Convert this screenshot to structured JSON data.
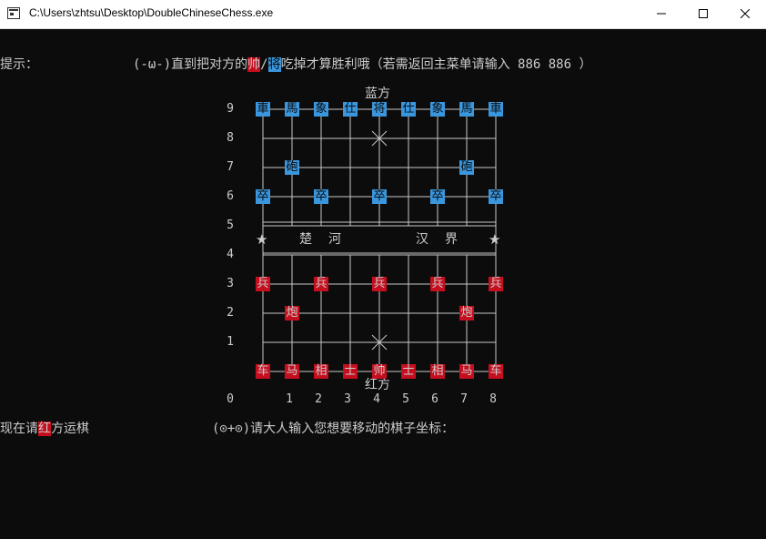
{
  "window": {
    "title": "C:\\Users\\zhtsu\\Desktop\\DoubleChineseChess.exe"
  },
  "console": {
    "hint_label": "提示：",
    "hint_prefix": "(-ω-)直到把对方的",
    "hint_red_piece": "帅",
    "hint_sep": "/",
    "hint_blue_piece": "将",
    "hint_suffix": "吃掉才算胜利哦（若需返回主菜单请输入 886 886 ）",
    "turn_prefix": "现在请",
    "turn_side": "红",
    "turn_suffix": "方运棋",
    "prompt": "(⊙+⊙)请大人输入您想要移动的棋子坐标：",
    "side_blue": "蓝方",
    "side_red": "红方",
    "river_left": [
      "楚",
      "河"
    ],
    "river_right": [
      "汉",
      "界"
    ],
    "river_marker_left": "★",
    "river_marker_right": "★",
    "row_labels": [
      "9",
      "8",
      "7",
      "6",
      "5",
      "4",
      "3",
      "2",
      "1"
    ],
    "col_labels": [
      "0",
      "1",
      "2",
      "3",
      "4",
      "5",
      "6",
      "7",
      "8"
    ],
    "palace_mark": "╳"
  },
  "pieces": {
    "blue": [
      {
        "label": "車",
        "col": 0,
        "row": 9
      },
      {
        "label": "馬",
        "col": 1,
        "row": 9
      },
      {
        "label": "象",
        "col": 2,
        "row": 9
      },
      {
        "label": "仕",
        "col": 3,
        "row": 9
      },
      {
        "label": "将",
        "col": 4,
        "row": 9
      },
      {
        "label": "仕",
        "col": 5,
        "row": 9
      },
      {
        "label": "象",
        "col": 6,
        "row": 9
      },
      {
        "label": "馬",
        "col": 7,
        "row": 9
      },
      {
        "label": "車",
        "col": 8,
        "row": 9
      },
      {
        "label": "砲",
        "col": 1,
        "row": 7
      },
      {
        "label": "砲",
        "col": 7,
        "row": 7
      },
      {
        "label": "卒",
        "col": 0,
        "row": 6
      },
      {
        "label": "卒",
        "col": 2,
        "row": 6
      },
      {
        "label": "卒",
        "col": 4,
        "row": 6
      },
      {
        "label": "卒",
        "col": 6,
        "row": 6
      },
      {
        "label": "卒",
        "col": 8,
        "row": 6
      }
    ],
    "red": [
      {
        "label": "兵",
        "col": 0,
        "row": 3
      },
      {
        "label": "兵",
        "col": 2,
        "row": 3
      },
      {
        "label": "兵",
        "col": 4,
        "row": 3
      },
      {
        "label": "兵",
        "col": 6,
        "row": 3
      },
      {
        "label": "兵",
        "col": 8,
        "row": 3
      },
      {
        "label": "炮",
        "col": 1,
        "row": 2
      },
      {
        "label": "炮",
        "col": 7,
        "row": 2
      },
      {
        "label": "车",
        "col": 0,
        "row": 0
      },
      {
        "label": "马",
        "col": 1,
        "row": 0
      },
      {
        "label": "相",
        "col": 2,
        "row": 0
      },
      {
        "label": "士",
        "col": 3,
        "row": 0
      },
      {
        "label": "帅",
        "col": 4,
        "row": 0
      },
      {
        "label": "士",
        "col": 5,
        "row": 0
      },
      {
        "label": "相",
        "col": 6,
        "row": 0
      },
      {
        "label": "马",
        "col": 7,
        "row": 0
      },
      {
        "label": "车",
        "col": 8,
        "row": 0
      }
    ]
  }
}
